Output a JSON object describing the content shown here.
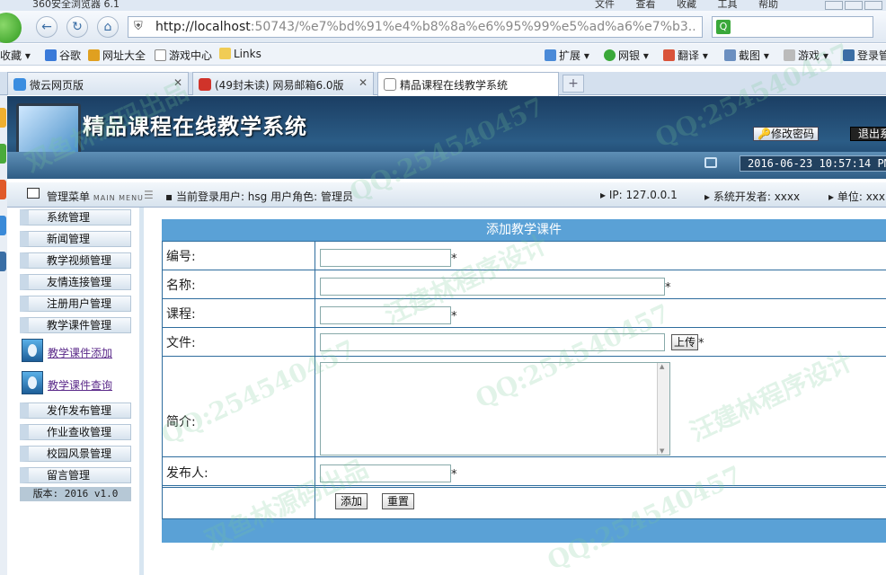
{
  "browser": {
    "app_name": "360安全浏览器 6.1",
    "menu": [
      "文件",
      "查看",
      "收藏",
      "工具",
      "帮助"
    ],
    "url_host": "http://localhost",
    "url_rest": ":50743/%e7%bd%91%e4%b8%8a%e6%95%99%e5%ad%a6%e7%b3...",
    "search_placeholder": "",
    "bookmarks_left": [
      "收藏",
      "谷歌",
      "网址大全",
      "游戏中心",
      "Links"
    ],
    "bookmarks_right": [
      "扩展",
      "网银",
      "翻译",
      "截图",
      "游戏",
      "登录管"
    ],
    "tabs": [
      "微云网页版",
      "(49封未读) 网易邮箱6.0版",
      "精品课程在线教学系统"
    ],
    "newtab": "+"
  },
  "header": {
    "title": "精品课程在线教学系统",
    "change_password": "修改密码",
    "logout": "退出系",
    "datetime": "2016-06-23 10:57:14 PM"
  },
  "infobar": {
    "menu_title": "管理菜单",
    "menu_title_en": "MAIN MENU",
    "current_user": "当前登录用户: hsg  用户角色: 管理员",
    "ip": "IP: 127.0.0.1",
    "developer": "系统开发者: xxxx",
    "unit": "单位: xxx"
  },
  "sidebar": {
    "items_top": [
      "系统管理",
      "新闻管理",
      "教学视频管理",
      "友情连接管理",
      "注册用户管理",
      "教学课件管理"
    ],
    "sublinks": [
      "教学课件添加",
      "教学课件查询"
    ],
    "items_bottom": [
      "发作发布管理",
      "作业查收管理",
      "校园风景管理",
      "留言管理"
    ],
    "version": "版本: 2016 v1.0"
  },
  "form": {
    "heading": "添加教学课件",
    "fields": {
      "code": {
        "label": "编号:",
        "value": ""
      },
      "name": {
        "label": "名称:",
        "value": ""
      },
      "course": {
        "label": "课程:",
        "value": ""
      },
      "file": {
        "label": "文件:",
        "value": "",
        "upload": "上传"
      },
      "intro": {
        "label": "简介:",
        "value": ""
      },
      "publisher": {
        "label": "发布人:",
        "value": ""
      }
    },
    "required_mark": "*",
    "submit": "添加",
    "reset": "重置"
  },
  "watermark": {
    "qq": "QQ:254540457",
    "author": "汪建林程序设计",
    "source": "双鱼林源码出品"
  },
  "colors": {
    "header_dark": "#1b3e63",
    "form_header": "#5aa1d6",
    "link_visited": "#5b2a8a"
  }
}
